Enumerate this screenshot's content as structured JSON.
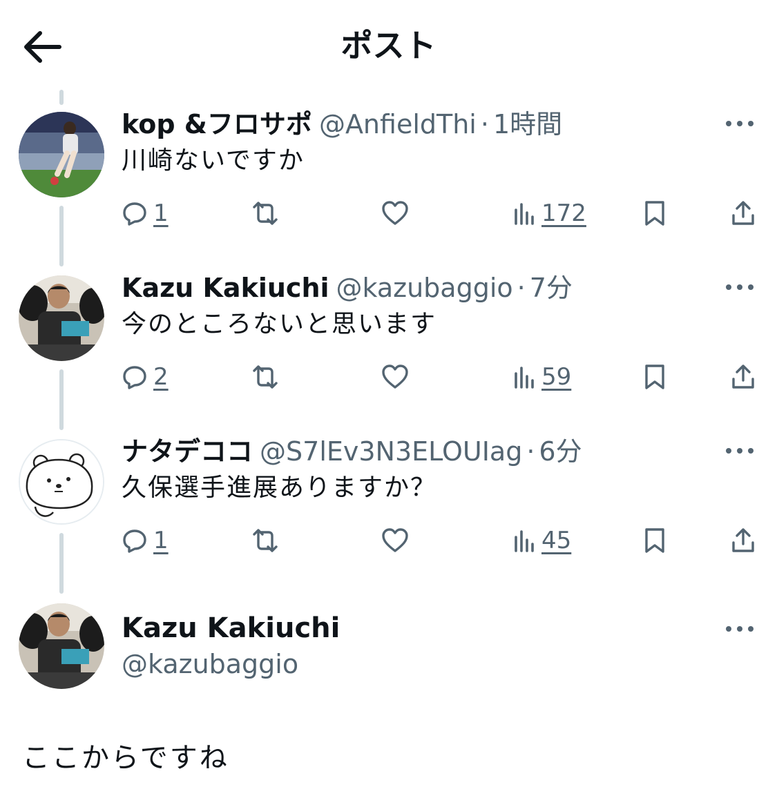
{
  "header": {
    "title": "ポスト",
    "back_icon": "arrow-left-icon"
  },
  "replies": [
    {
      "name": "kop &フロサポ",
      "handle": "@AnfieldThi",
      "time": "1時間",
      "text": "川崎ないですか",
      "replies": "1",
      "views": "172"
    },
    {
      "name": "Kazu Kakiuchi",
      "handle": "@kazubaggio",
      "time": "7分",
      "text": "今のところないと思います",
      "replies": "2",
      "views": "59"
    },
    {
      "name": "ナタデココ",
      "handle": "@S7lEv3N3ELOUIag",
      "time": "6分",
      "text": "久保選手進展ありますか？",
      "replies": "1",
      "views": "45"
    }
  ],
  "main_post": {
    "name": "Kazu Kakiuchi",
    "handle": "@kazubaggio",
    "text": "ここからですね"
  },
  "separator": "·",
  "colors": {
    "text": "#0f1419",
    "secondary": "#536471",
    "thread_line": "#cfd9de"
  }
}
